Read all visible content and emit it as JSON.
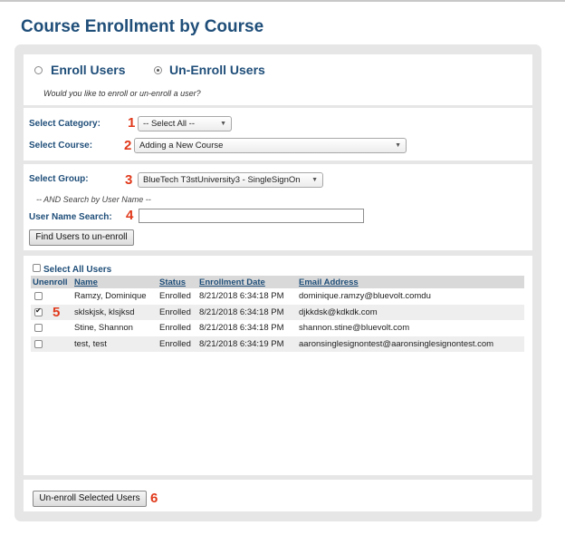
{
  "page_title": "Course Enrollment by Course",
  "mode": {
    "enroll_label": "Enroll Users",
    "unenroll_label": "Un-Enroll Users",
    "selected": "unenroll",
    "hint": "Would you like to enroll or un-enroll a user?"
  },
  "filters": {
    "category_label": "Select Category:",
    "category_value": "-- Select All --",
    "course_label": "Select Course:",
    "course_value": "Adding a New Course"
  },
  "search": {
    "group_label": "Select Group:",
    "group_value": "BlueTech T3stUniversity3 - SingleSignOn",
    "and_hint": "-- AND Search by User Name --",
    "username_label": "User Name Search:",
    "username_value": "",
    "find_button": "Find Users to un-enroll"
  },
  "steps": [
    "1",
    "2",
    "3",
    "4",
    "5",
    "6"
  ],
  "results": {
    "select_all_label": "Select All Users",
    "columns": [
      "Unenroll",
      "Name",
      "Status",
      "Enrollment Date",
      "Email Address"
    ],
    "rows": [
      {
        "checked": false,
        "name": "Ramzy, Dominique",
        "status": "Enrolled",
        "date": "8/21/2018 6:34:18 PM",
        "email": "dominique.ramzy@bluevolt.comdu"
      },
      {
        "checked": true,
        "name": "sklskjsk, klsjksd",
        "status": "Enrolled",
        "date": "8/21/2018 6:34:18 PM",
        "email": "djkkdsk@kdkdk.com"
      },
      {
        "checked": false,
        "name": "Stine, Shannon",
        "status": "Enrolled",
        "date": "8/21/2018 6:34:18 PM",
        "email": "shannon.stine@bluevolt.com"
      },
      {
        "checked": false,
        "name": "test, test",
        "status": "Enrolled",
        "date": "8/21/2018 6:34:19 PM",
        "email": "aaronsinglesignontest@aaronsinglesignontest.com"
      }
    ]
  },
  "footer": {
    "unenroll_button": "Un-enroll Selected Users"
  },
  "colors": {
    "heading_blue": "#1f4e79",
    "step_red": "#e0391b",
    "panel_gray": "#e6e6e6"
  }
}
